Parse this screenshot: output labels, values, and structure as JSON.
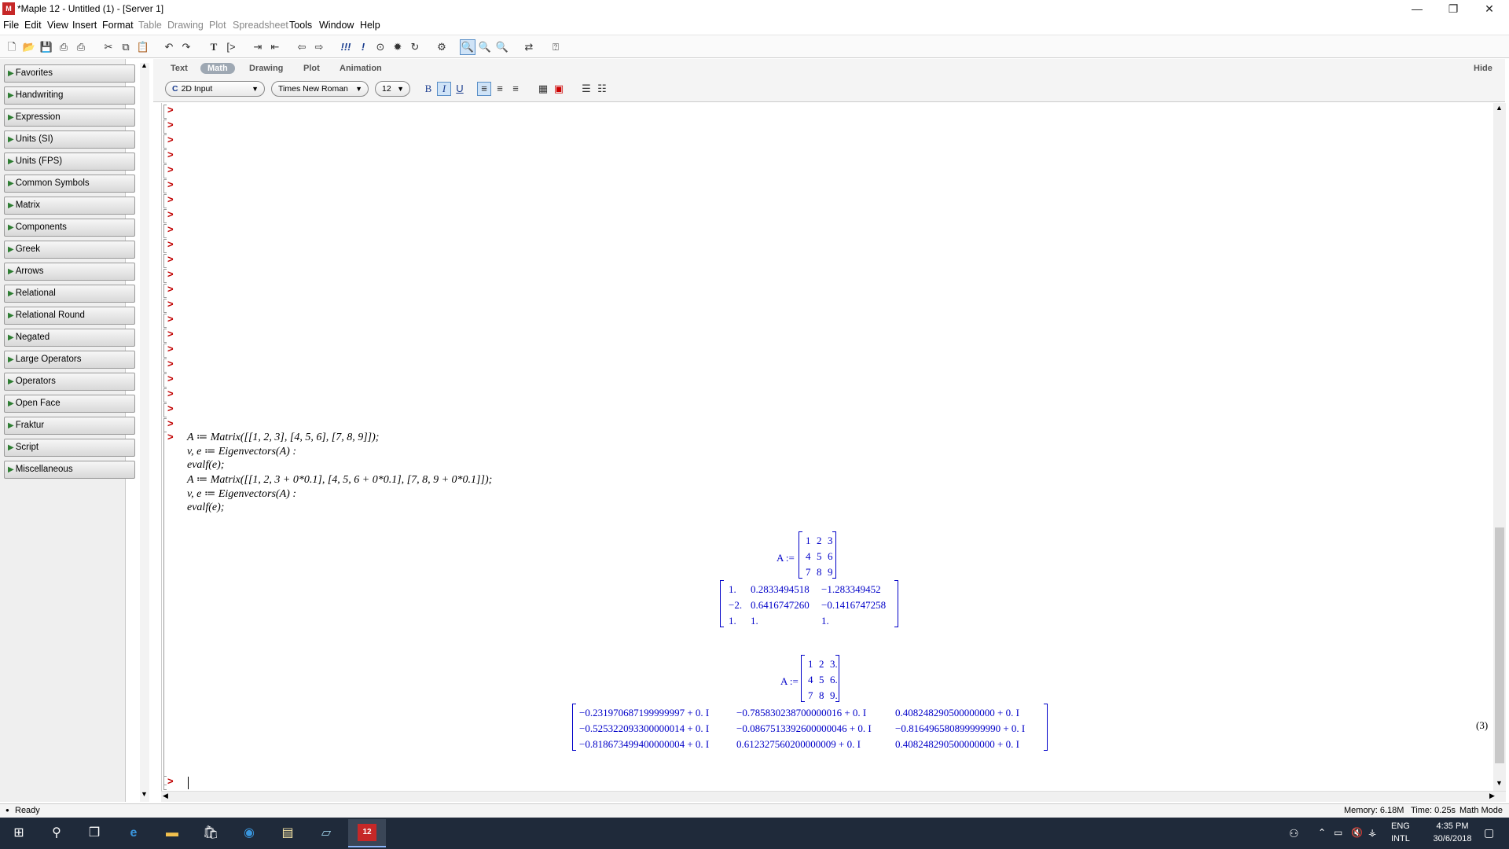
{
  "window": {
    "title": "*Maple 12 - Untitled (1) - [Server 1]",
    "minimize": "—",
    "restore": "❐",
    "close": "✕"
  },
  "menu": [
    "File",
    "Edit",
    "View",
    "Insert",
    "Format",
    "Table",
    "Drawing",
    "Plot",
    "Spreadsheet",
    "Tools",
    "Window",
    "Help"
  ],
  "palettes": [
    "Favorites",
    "Handwriting",
    "Expression",
    "Units (SI)",
    "Units (FPS)",
    "Common Symbols",
    "Matrix",
    "Components",
    "Greek",
    "Arrows",
    "Relational",
    "Relational Round",
    "Negated",
    "Large Operators",
    "Operators",
    "Open Face",
    "Fraktur",
    "Script",
    "Miscellaneous"
  ],
  "context_tabs": [
    "Text",
    "Math",
    "Drawing",
    "Plot",
    "Animation"
  ],
  "context_tab_active": "Math",
  "hide_label": "Hide",
  "format": {
    "input_mode": "2D Input",
    "input_mode_icon": "C",
    "font": "Times New Roman",
    "size": "12",
    "bold": "B",
    "italic": "I",
    "underline": "U"
  },
  "prompt": ">",
  "code_lines": [
    "A ≔ Matrix([[1, 2, 3], [4, 5, 6], [7, 8, 9]]);",
    "v, e ≔ Eigenvectors(A) :",
    "evalf(e);",
    "A ≔ Matrix([[1, 2, 3 + 0*0.1], [4, 5, 6 + 0*0.1], [7, 8, 9 + 0*0.1]]);",
    "v, e ≔ Eigenvectors(A) :",
    "evalf(e);"
  ],
  "outputs": {
    "assign_label": "A :=",
    "m1": [
      [
        "1",
        "2",
        "3"
      ],
      [
        "4",
        "5",
        "6"
      ],
      [
        "7",
        "8",
        "9"
      ]
    ],
    "m2": [
      [
        "1.",
        "0.2833494518",
        "−1.283349452"
      ],
      [
        "−2.",
        "0.6416747260",
        "−0.1416747258"
      ],
      [
        "1.",
        "1.",
        "1."
      ]
    ],
    "m3": [
      [
        "1",
        "2",
        "3."
      ],
      [
        "4",
        "5",
        "6."
      ],
      [
        "7",
        "8",
        "9."
      ]
    ],
    "m4": [
      [
        "−0.231970687199999997 + 0. I",
        "−0.785830238700000016 + 0. I",
        "0.408248290500000000 + 0. I"
      ],
      [
        "−0.525322093300000014 + 0. I",
        "−0.0867513392600000046 + 0. I",
        "−0.816496580899999990 + 0. I"
      ],
      [
        "−0.818673499400000004 + 0. I",
        "0.612327560200000009 + 0. I",
        "0.408248290500000000 + 0. I"
      ]
    ],
    "eq_label": "(3)"
  },
  "status": {
    "ready": "Ready",
    "memory": "Memory: 6.18M",
    "time": "Time: 0.25s",
    "mode": "Math Mode"
  },
  "taskbar": {
    "lang1": "ENG",
    "lang2": "INTL",
    "clock_time": "4:35 PM",
    "clock_date": "30/6/2018"
  }
}
